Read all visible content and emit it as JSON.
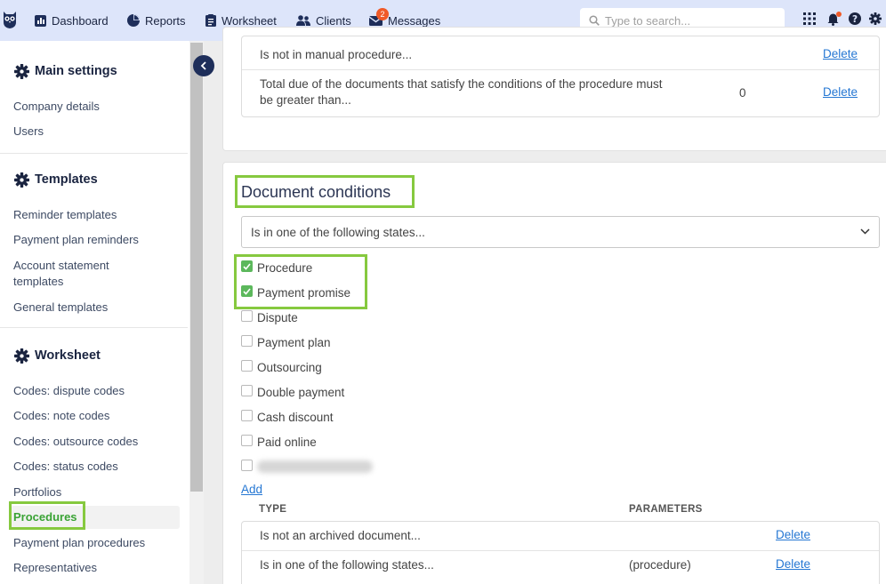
{
  "nav": {
    "items": [
      {
        "label": "Dashboard",
        "icon": "chart-icon"
      },
      {
        "label": "Reports",
        "icon": "pie-icon"
      },
      {
        "label": "Worksheet",
        "icon": "clipboard-icon"
      },
      {
        "label": "Clients",
        "icon": "users-icon"
      },
      {
        "label": "Messages",
        "icon": "envelope-icon",
        "badge": "2"
      }
    ],
    "search_placeholder": "Type to search..."
  },
  "sidebar": {
    "sections": [
      {
        "title": "Main settings",
        "items": [
          "Company details",
          "Users"
        ]
      },
      {
        "title": "Templates",
        "items": [
          "Reminder templates",
          "Payment plan reminders",
          "Account statement templates",
          "General templates"
        ]
      },
      {
        "title": "Worksheet",
        "items": [
          "Codes: dispute codes",
          "Codes: note codes",
          "Codes: outsource codes",
          "Codes: status codes",
          "Portfolios",
          "Procedures",
          "Payment plan procedures",
          "Representatives"
        ]
      }
    ],
    "account_statement_line1": "Account statement",
    "account_statement_line2": "templates",
    "active_item": "Procedures"
  },
  "top_table": {
    "rows": [
      {
        "type": "Is not in manual procedure...",
        "param": "",
        "action": "Delete"
      },
      {
        "type_line1": "Total due of the documents that satisfy the conditions of the procedure must",
        "type_line2": "be greater than...",
        "param": "0",
        "action": "Delete"
      }
    ]
  },
  "doc_conditions": {
    "title": "Document conditions",
    "select_value": "Is in one of the following states...",
    "options": [
      {
        "label": "Procedure",
        "checked": true
      },
      {
        "label": "Payment promise",
        "checked": true
      },
      {
        "label": "Dispute",
        "checked": false
      },
      {
        "label": "Payment plan",
        "checked": false
      },
      {
        "label": "Outsourcing",
        "checked": false
      },
      {
        "label": "Double payment",
        "checked": false
      },
      {
        "label": "Cash discount",
        "checked": false
      },
      {
        "label": "Paid online",
        "checked": false
      }
    ],
    "add_label": "Add",
    "col_type": "TYPE",
    "col_params": "PARAMETERS",
    "rows": [
      {
        "type": "Is not an archived document...",
        "param": "",
        "action": "Delete"
      },
      {
        "type": "Is in one of the following states...",
        "param": "(procedure)",
        "action": "Delete"
      }
    ]
  },
  "colors": {
    "nav_bg": "#dde5fa",
    "highlight": "#86c93f",
    "link": "#2577d3",
    "active": "#3aa335"
  }
}
